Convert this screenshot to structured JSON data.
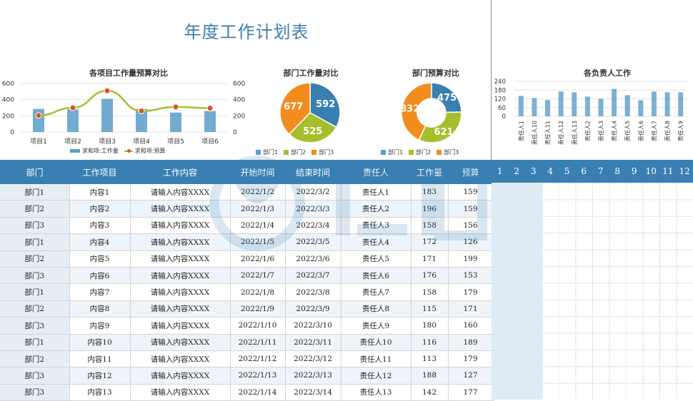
{
  "title": "年度工作计划表",
  "colors": {
    "blue": "#3f7fb0",
    "bar": "#5a9ec8",
    "green": "#a8bd2d",
    "orange": "#f28c1c",
    "dot": "#e0532a"
  },
  "chart1": {
    "title": "各项目工作量预算对比",
    "type": "bar+line",
    "categories": [
      "项目1",
      "项目2",
      "项目3",
      "项目4",
      "项目5",
      "项目6"
    ],
    "y_ticks": [
      "600",
      "400",
      "200",
      "0"
    ],
    "y_ticks_right": [
      "600",
      "400",
      "200",
      "0"
    ],
    "bar_values": [
      285,
      280,
      410,
      285,
      240,
      260
    ],
    "line_values": [
      205,
      300,
      510,
      260,
      310,
      295
    ],
    "ylim": [
      0,
      600
    ],
    "legend": [
      "求和项:工作量",
      "求和项:预算"
    ]
  },
  "chart2": {
    "title": "部门工作量对比",
    "type": "pie",
    "labels": [
      "部门1",
      "部门2",
      "部门3"
    ],
    "values": [
      592,
      525,
      677
    ],
    "value_labels": [
      "592",
      "525",
      "677"
    ]
  },
  "chart3": {
    "title": "部门预算对比",
    "type": "donut",
    "labels": [
      "部门1",
      "部门2",
      "部门3"
    ],
    "values": [
      475,
      621,
      832
    ],
    "value_labels": [
      "475",
      "621",
      "832"
    ]
  },
  "chart4": {
    "title": "各负责人工作",
    "type": "bar",
    "categories": [
      "责任人1",
      "责任人10",
      "责任人11",
      "责任人12",
      "责任人13",
      "责任人2",
      "责任人3",
      "责任人4",
      "责任人5",
      "责任人6",
      "责任人7",
      "责任人8",
      "责任人9"
    ],
    "values": [
      140,
      125,
      113,
      170,
      165,
      135,
      120,
      188,
      145,
      110,
      170,
      165,
      165
    ],
    "y_ticks": [
      "240",
      "180",
      "120",
      "60",
      "0"
    ],
    "ylim": [
      0,
      240
    ]
  },
  "table": {
    "headers": [
      "部门",
      "工作项目",
      "工作内容",
      "开始时间",
      "结束时间",
      "责任人",
      "工作量",
      "预算"
    ],
    "rows": [
      [
        "部门1",
        "内容1",
        "请输入内容XXXX",
        "2022/1/2",
        "2022/3/2",
        "责任人1",
        "183",
        "159"
      ],
      [
        "部门2",
        "内容2",
        "请输入内容XXXX",
        "2022/1/3",
        "2022/3/3",
        "责任人2",
        "196",
        "159"
      ],
      [
        "部门3",
        "内容3",
        "请输入内容XXXX",
        "2022/1/4",
        "2022/3/4",
        "责任人3",
        "158",
        "156"
      ],
      [
        "部门1",
        "内容4",
        "请输入内容XXXX",
        "2022/1/5",
        "2022/3/5",
        "责任人4",
        "172",
        "126"
      ],
      [
        "部门2",
        "内容5",
        "请输入内容XXXX",
        "2022/1/6",
        "2022/3/6",
        "责任人5",
        "171",
        "199"
      ],
      [
        "部门3",
        "内容6",
        "请输入内容XXXX",
        "2022/1/7",
        "2022/3/7",
        "责任人6",
        "176",
        "153"
      ],
      [
        "部门1",
        "内容7",
        "请输入内容XXXX",
        "2022/1/8",
        "2022/3/8",
        "责任人7",
        "158",
        "179"
      ],
      [
        "部门2",
        "内容8",
        "请输入内容XXXX",
        "2022/1/9",
        "2022/3/9",
        "责任人8",
        "115",
        "171"
      ],
      [
        "部门3",
        "内容9",
        "请输入内容XXXX",
        "2022/1/10",
        "2022/3/10",
        "责任人9",
        "180",
        "160"
      ],
      [
        "部门1",
        "内容10",
        "请输入内容XXXX",
        "2022/1/11",
        "2022/3/11",
        "责任人10",
        "116",
        "189"
      ],
      [
        "部门2",
        "内容11",
        "请输入内容XXXX",
        "2022/1/12",
        "2022/3/12",
        "责任人11",
        "113",
        "179"
      ],
      [
        "部门3",
        "内容12",
        "请输入内容XXXX",
        "2022/1/13",
        "2022/3/13",
        "责任人12",
        "188",
        "127"
      ],
      [
        "部门3",
        "内容13",
        "请输入内容XXXX",
        "2022/1/14",
        "2022/3/14",
        "责任人13",
        "142",
        "177"
      ]
    ]
  },
  "months": [
    "1",
    "2",
    "3",
    "4",
    "5",
    "6",
    "7",
    "8",
    "9",
    "10",
    "11",
    "12"
  ]
}
